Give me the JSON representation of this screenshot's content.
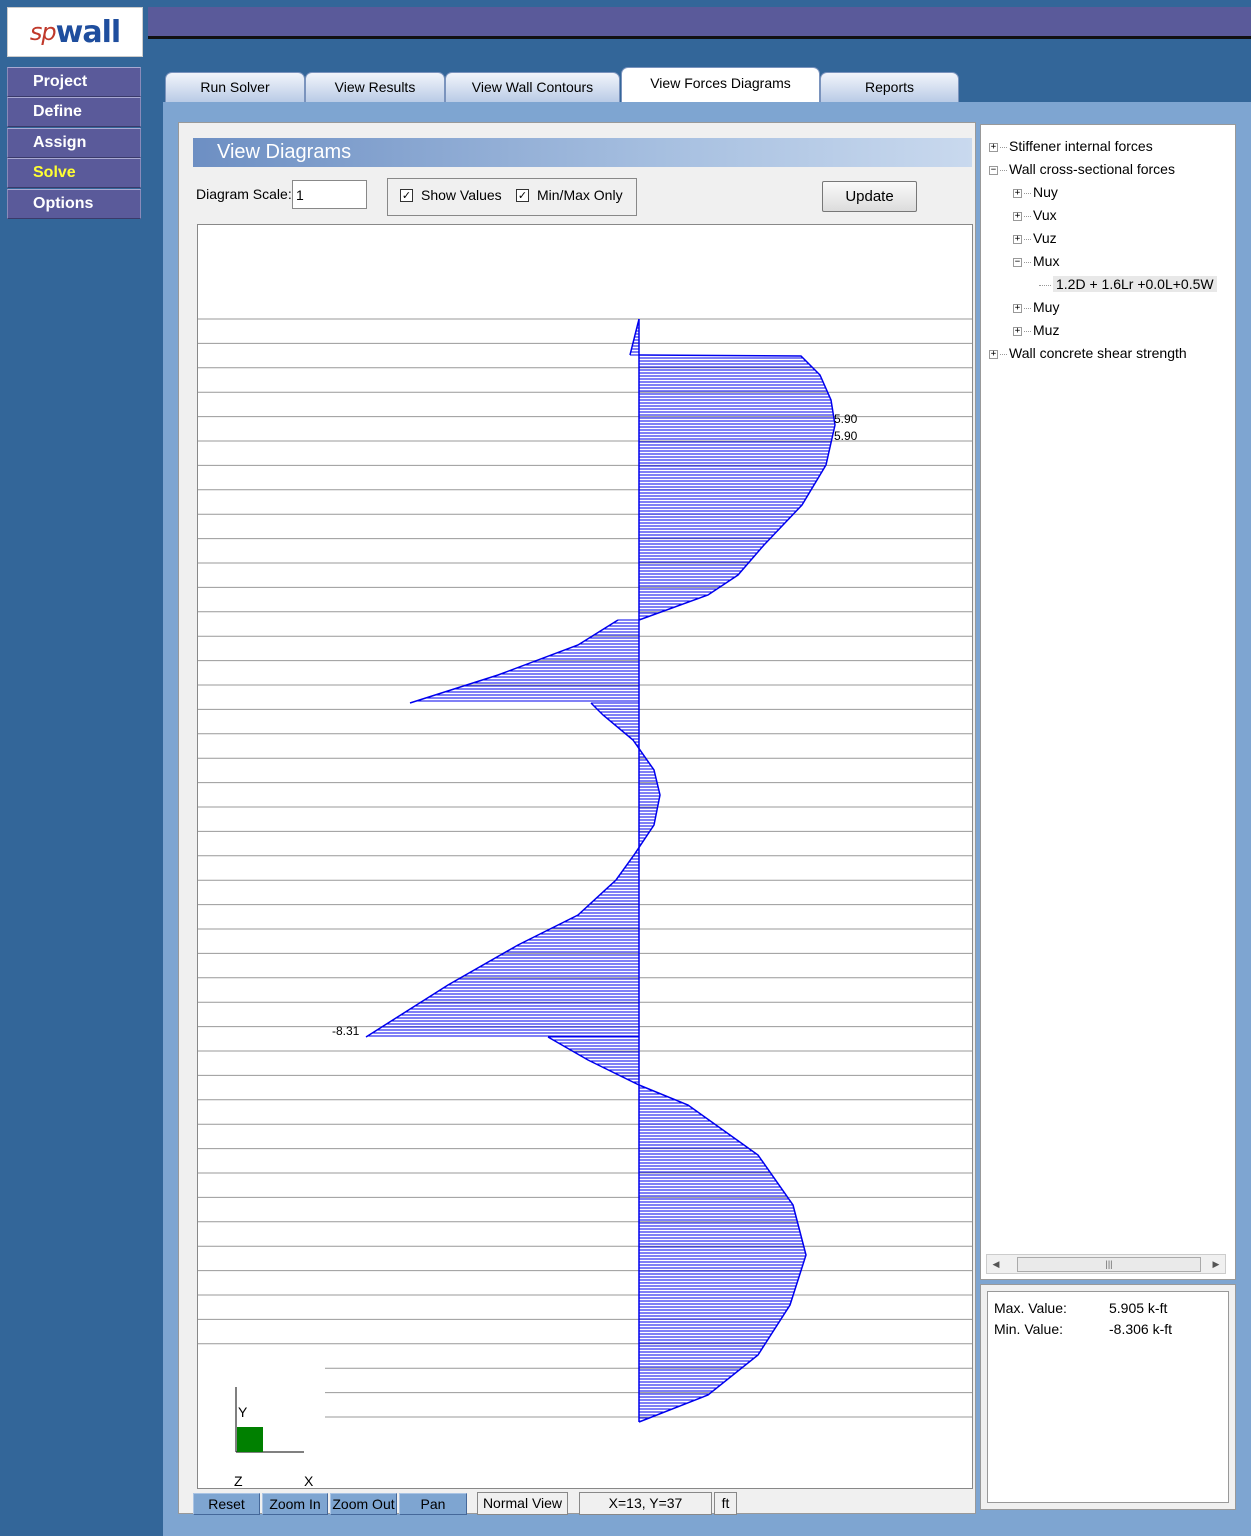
{
  "app": {
    "logo_prefix": "sp",
    "logo_main": "wall"
  },
  "sidebar": {
    "items": [
      {
        "label": "Project",
        "active": false
      },
      {
        "label": "Define",
        "active": false
      },
      {
        "label": "Assign",
        "active": false
      },
      {
        "label": "Solve",
        "active": true
      },
      {
        "label": "Options",
        "active": false
      }
    ]
  },
  "tabs": [
    {
      "label": "Run Solver"
    },
    {
      "label": "View Results"
    },
    {
      "label": "View Wall Contours"
    },
    {
      "label": "View Forces Diagrams",
      "active": true
    },
    {
      "label": "Reports"
    }
  ],
  "view": {
    "title": "View Diagrams",
    "scale_label": "Diagram Scale:",
    "scale_value": "1",
    "show_values_label": "Show Values",
    "show_values_checked": true,
    "minmax_label": "Min/Max Only",
    "minmax_checked": true,
    "update_label": "Update"
  },
  "diagram": {
    "color": "#0000ee",
    "max_label": "5.90",
    "max_label_2": "5.90",
    "min_label": "-8.31",
    "axis_y": "Y",
    "axis_z": "Z",
    "axis_x": "X"
  },
  "toolbar": {
    "reset_label": "Reset",
    "zoom_in_label": "Zoom In",
    "zoom_out_label": "Zoom Out",
    "pan_label": "Pan",
    "view_mode": "Normal View",
    "coords": "X=13, Y=37",
    "units": "ft"
  },
  "tree": {
    "stiffener": "Stiffener internal forces",
    "wall_cross": "Wall cross-sectional forces",
    "nuy": "Nuy",
    "vux": "Vux",
    "vuz": "Vuz",
    "mux": "Mux",
    "combo": "1.2D + 1.6Lr +0.0L+0.5W",
    "muy": "Muy",
    "muz": "Muz",
    "shear": "Wall concrete shear strength"
  },
  "values": {
    "max_label": "Max. Value:",
    "max_value": "5.905 k-ft",
    "min_label": "Min. Value:",
    "min_value": "-8.306 k-ft"
  }
}
